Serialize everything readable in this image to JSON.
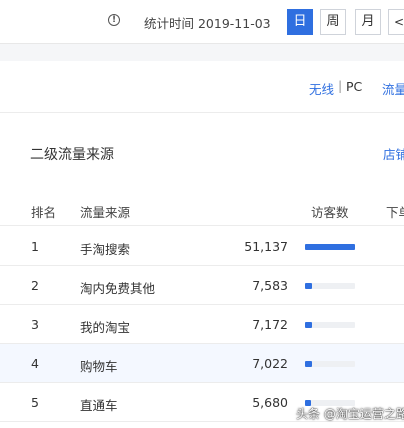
{
  "header": {
    "info_icon": "info-circle-icon",
    "stat_time": "统计时间 2019-11-03",
    "periods": [
      "日",
      "周",
      "月"
    ],
    "active_period": "日",
    "prev_icon": "chevron-left-icon",
    "prev_label": "<",
    "accent": "#2f6fe0"
  },
  "filters": {
    "wireless": "无线",
    "sep": "|",
    "pc": "PC",
    "traffic": "流量"
  },
  "section": {
    "title": "二级流量来源",
    "store_link": "店铺"
  },
  "table": {
    "columns": [
      "排名",
      "流量来源",
      "访客数",
      "下单"
    ],
    "rows": [
      {
        "rank": "1",
        "source": "手淘搜索",
        "visits": "51,137",
        "share": 1.0
      },
      {
        "rank": "2",
        "source": "淘内免费其他",
        "visits": "7,583",
        "share": 0.148
      },
      {
        "rank": "3",
        "source": "我的淘宝",
        "visits": "7,172",
        "share": 0.14
      },
      {
        "rank": "4",
        "source": "购物车",
        "visits": "7,022",
        "share": 0.137
      },
      {
        "rank": "5",
        "source": "直通车",
        "visits": "5,680",
        "share": 0.111
      }
    ]
  },
  "watermark": "头条 @淘宝运营之路"
}
